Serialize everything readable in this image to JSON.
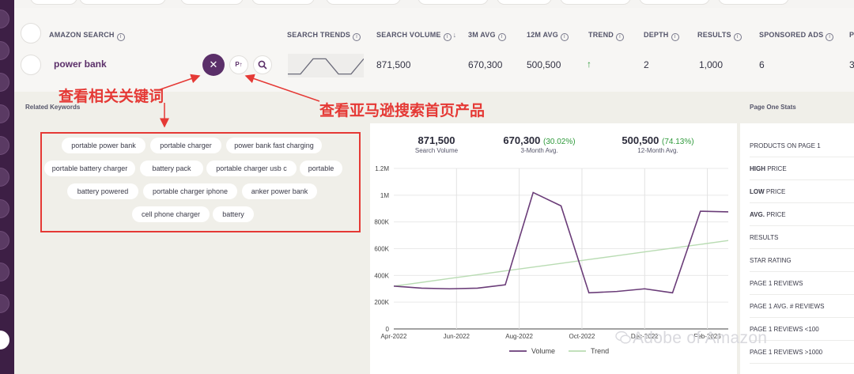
{
  "table": {
    "headers": {
      "keyword": "AMAZON SEARCH",
      "trends": "SEARCH TRENDS",
      "volume": "SEARCH VOLUME",
      "avg3m": "3M AVG",
      "avg12m": "12M AVG",
      "trend": "TREND",
      "depth": "DEPTH",
      "results": "RESULTS",
      "sponsored": "SPONSORED ADS",
      "cut": "P"
    },
    "row": {
      "keyword": "power bank",
      "products_btn": "P↑",
      "volume": "871,500",
      "avg3m": "670,300",
      "avg12m": "500,500",
      "trend": "↑",
      "depth": "2",
      "results": "1,000",
      "sponsored": "6",
      "cut": "3"
    },
    "sparkline": [
      0.1,
      0.1,
      0.9,
      0.9,
      0.1,
      0.1,
      0.9
    ]
  },
  "related": {
    "title": "Related Keywords",
    "tags": [
      "portable power bank",
      "portable charger",
      "power bank fast charging",
      "portable battery charger",
      "battery pack",
      "portable charger usb c",
      "portable",
      "battery powered",
      "portable charger iphone",
      "anker power bank",
      "cell phone charger",
      "battery"
    ]
  },
  "stats": {
    "volume": {
      "value": "871,500",
      "label": "Search Volume"
    },
    "avg3m": {
      "value": "670,300",
      "pct": "(30.02%)",
      "label": "3-Month Avg."
    },
    "avg12m": {
      "value": "500,500",
      "pct": "(74.13%)",
      "label": "12-Month Avg."
    }
  },
  "page_one": {
    "title": "Page One Stats",
    "rows": [
      {
        "bold": "",
        "text": "PRODUCTS ON PAGE 1"
      },
      {
        "bold": "HIGH",
        "text": " PRICE"
      },
      {
        "bold": "LOW",
        "text": " PRICE"
      },
      {
        "bold": "AVG.",
        "text": " PRICE"
      },
      {
        "bold": "",
        "text": "RESULTS"
      },
      {
        "bold": "",
        "text": "STAR RATING"
      },
      {
        "bold": "",
        "text": "PAGE 1 REVIEWS"
      },
      {
        "bold": "",
        "text": "PAGE 1 AVG. # REVIEWS"
      },
      {
        "bold": "",
        "text": "PAGE 1 REVIEWS <100"
      },
      {
        "bold": "",
        "text": "PAGE 1 REVIEWS >1000"
      }
    ]
  },
  "annotations": {
    "related": "查看相关关键词",
    "products": "查看亚马逊搜索首页产品"
  },
  "watermark": "Adobe of Amazon",
  "colors": {
    "brand": "#5b2f69",
    "line": "#6a3c78",
    "trend": "#b9dcb3",
    "positive": "#2f9a3b",
    "annotation": "#e53935"
  },
  "chart_data": {
    "type": "line",
    "x_labels": [
      "Apr-2022",
      "Jun-2022",
      "Aug-2022",
      "Oct-2022",
      "Dec-2022",
      "Feb-2023"
    ],
    "x": [
      0,
      1,
      2,
      3,
      4,
      5,
      6,
      7,
      8,
      9,
      10,
      11,
      12
    ],
    "series": [
      {
        "name": "Volume",
        "values": [
          320000,
          305000,
          300000,
          305000,
          330000,
          1020000,
          920000,
          270000,
          280000,
          300000,
          270000,
          880000,
          875000
        ]
      },
      {
        "name": "Trend",
        "values": [
          320000,
          348000,
          377000,
          405000,
          434000,
          462000,
          490000,
          519000,
          547000,
          576000,
          604000,
          632000,
          661000
        ]
      }
    ],
    "yticks": [
      "0",
      "200K",
      "400K",
      "600K",
      "800K",
      "1M",
      "1.2M"
    ],
    "ylim": [
      0,
      1200000
    ],
    "grid": true,
    "legend": "bottom"
  }
}
